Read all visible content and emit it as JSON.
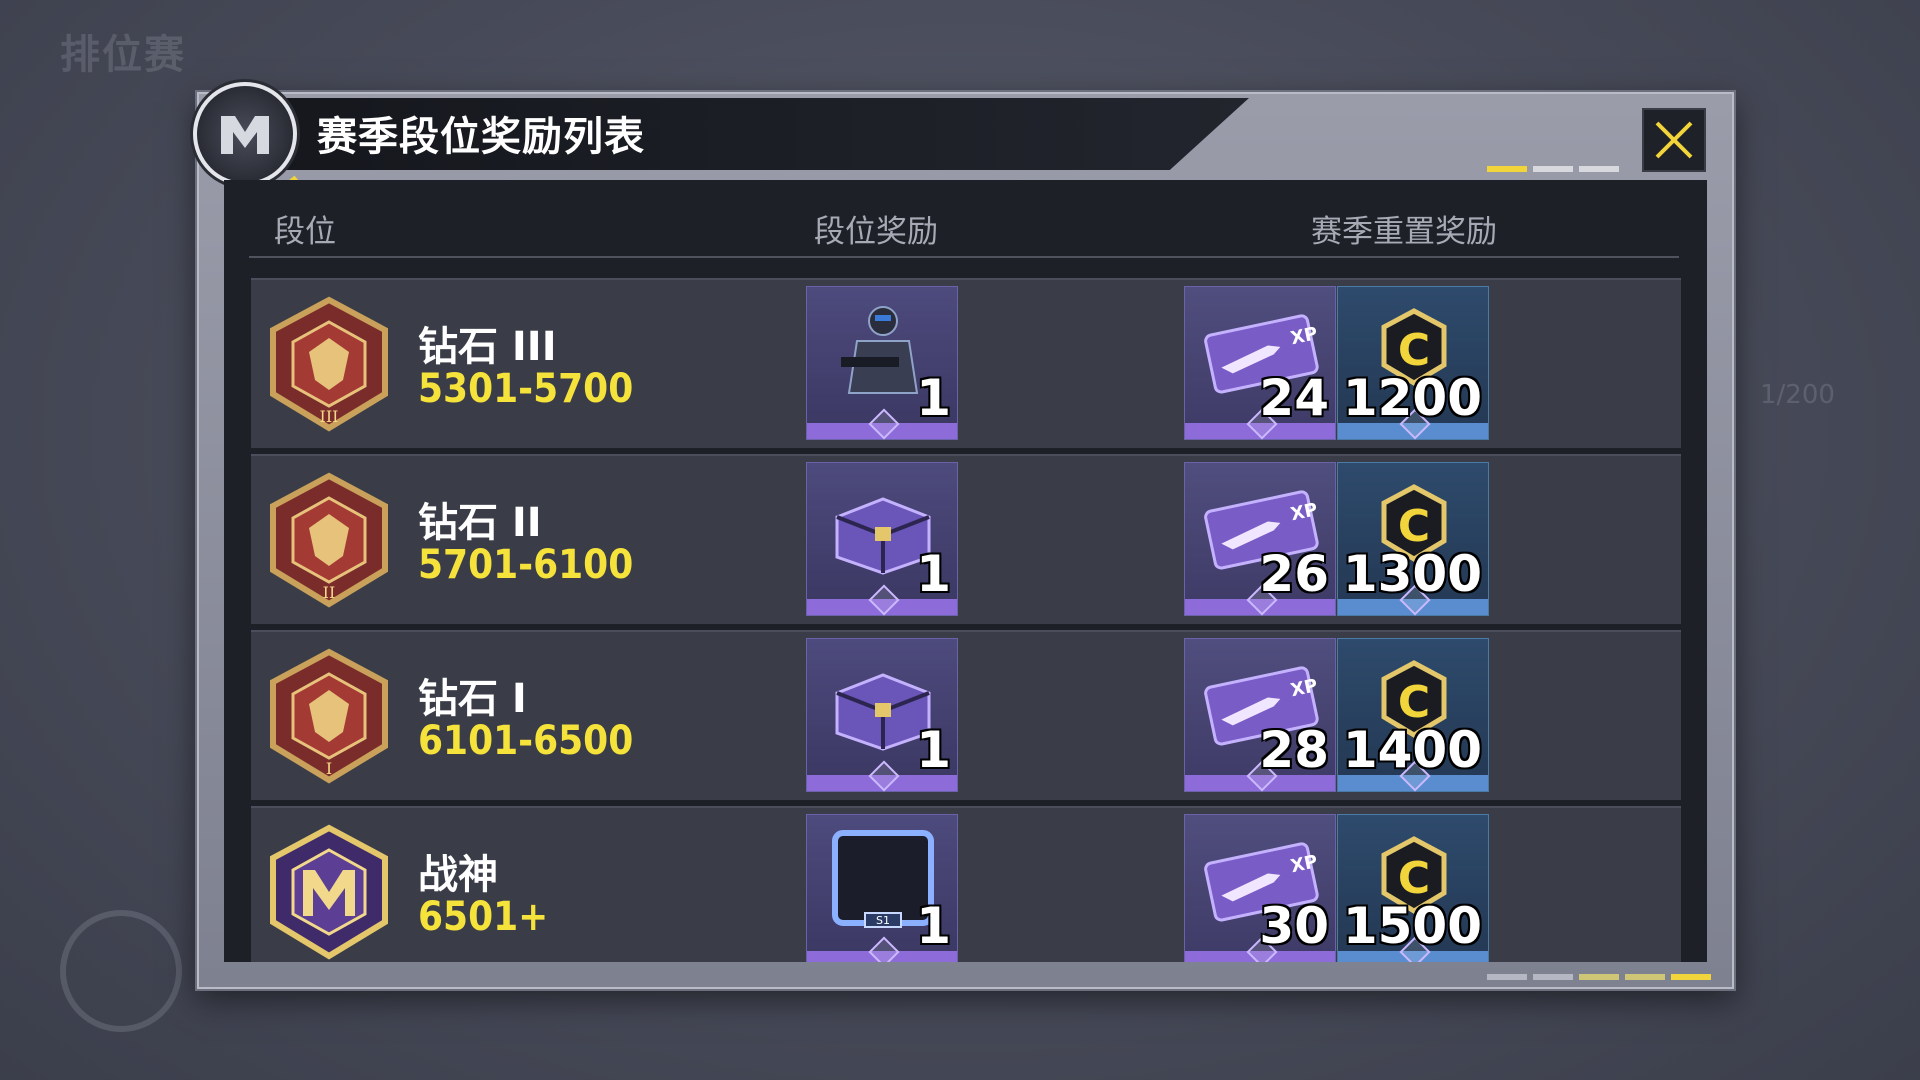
{
  "background": {
    "title": "排位赛",
    "counter": "1/200"
  },
  "modal": {
    "title": "赛季段位奖励列表",
    "close_icon": "close-x-icon",
    "accent_color": "#f2d43b"
  },
  "table": {
    "headers": {
      "rank": "段位",
      "rank_reward": "段位奖励",
      "season_reset_reward": "赛季重置奖励"
    },
    "rows": [
      {
        "rank": "钻石 III",
        "range": "5301-5700",
        "emblem": "diamond-3-emblem",
        "rank_reward": {
          "icon": "operator-skin-icon",
          "qty": "1"
        },
        "xp": {
          "icon": "xp-card-icon",
          "qty": "24"
        },
        "cp": {
          "icon": "cod-points-icon",
          "qty": "1200"
        }
      },
      {
        "rank": "钻石 II",
        "range": "5701-6100",
        "emblem": "diamond-2-emblem",
        "rank_reward": {
          "icon": "supply-crate-icon",
          "qty": "1"
        },
        "xp": {
          "icon": "xp-card-icon",
          "qty": "26"
        },
        "cp": {
          "icon": "cod-points-icon",
          "qty": "1300"
        }
      },
      {
        "rank": "钻石 I",
        "range": "6101-6500",
        "emblem": "diamond-1-emblem",
        "rank_reward": {
          "icon": "supply-crate-icon",
          "qty": "1"
        },
        "xp": {
          "icon": "xp-card-icon",
          "qty": "28"
        },
        "cp": {
          "icon": "cod-points-icon",
          "qty": "1400"
        }
      },
      {
        "rank": "战神",
        "range": "6501+",
        "emblem": "legendary-emblem",
        "rank_reward": {
          "icon": "avatar-frame-icon",
          "qty": "1"
        },
        "xp": {
          "icon": "xp-card-icon",
          "qty": "30"
        },
        "cp": {
          "icon": "cod-points-icon",
          "qty": "1500"
        }
      }
    ]
  },
  "colors": {
    "range_text": "#f5e23a",
    "purple_bar": "#8d6cd9",
    "blue_bar": "#5a8cd0"
  }
}
